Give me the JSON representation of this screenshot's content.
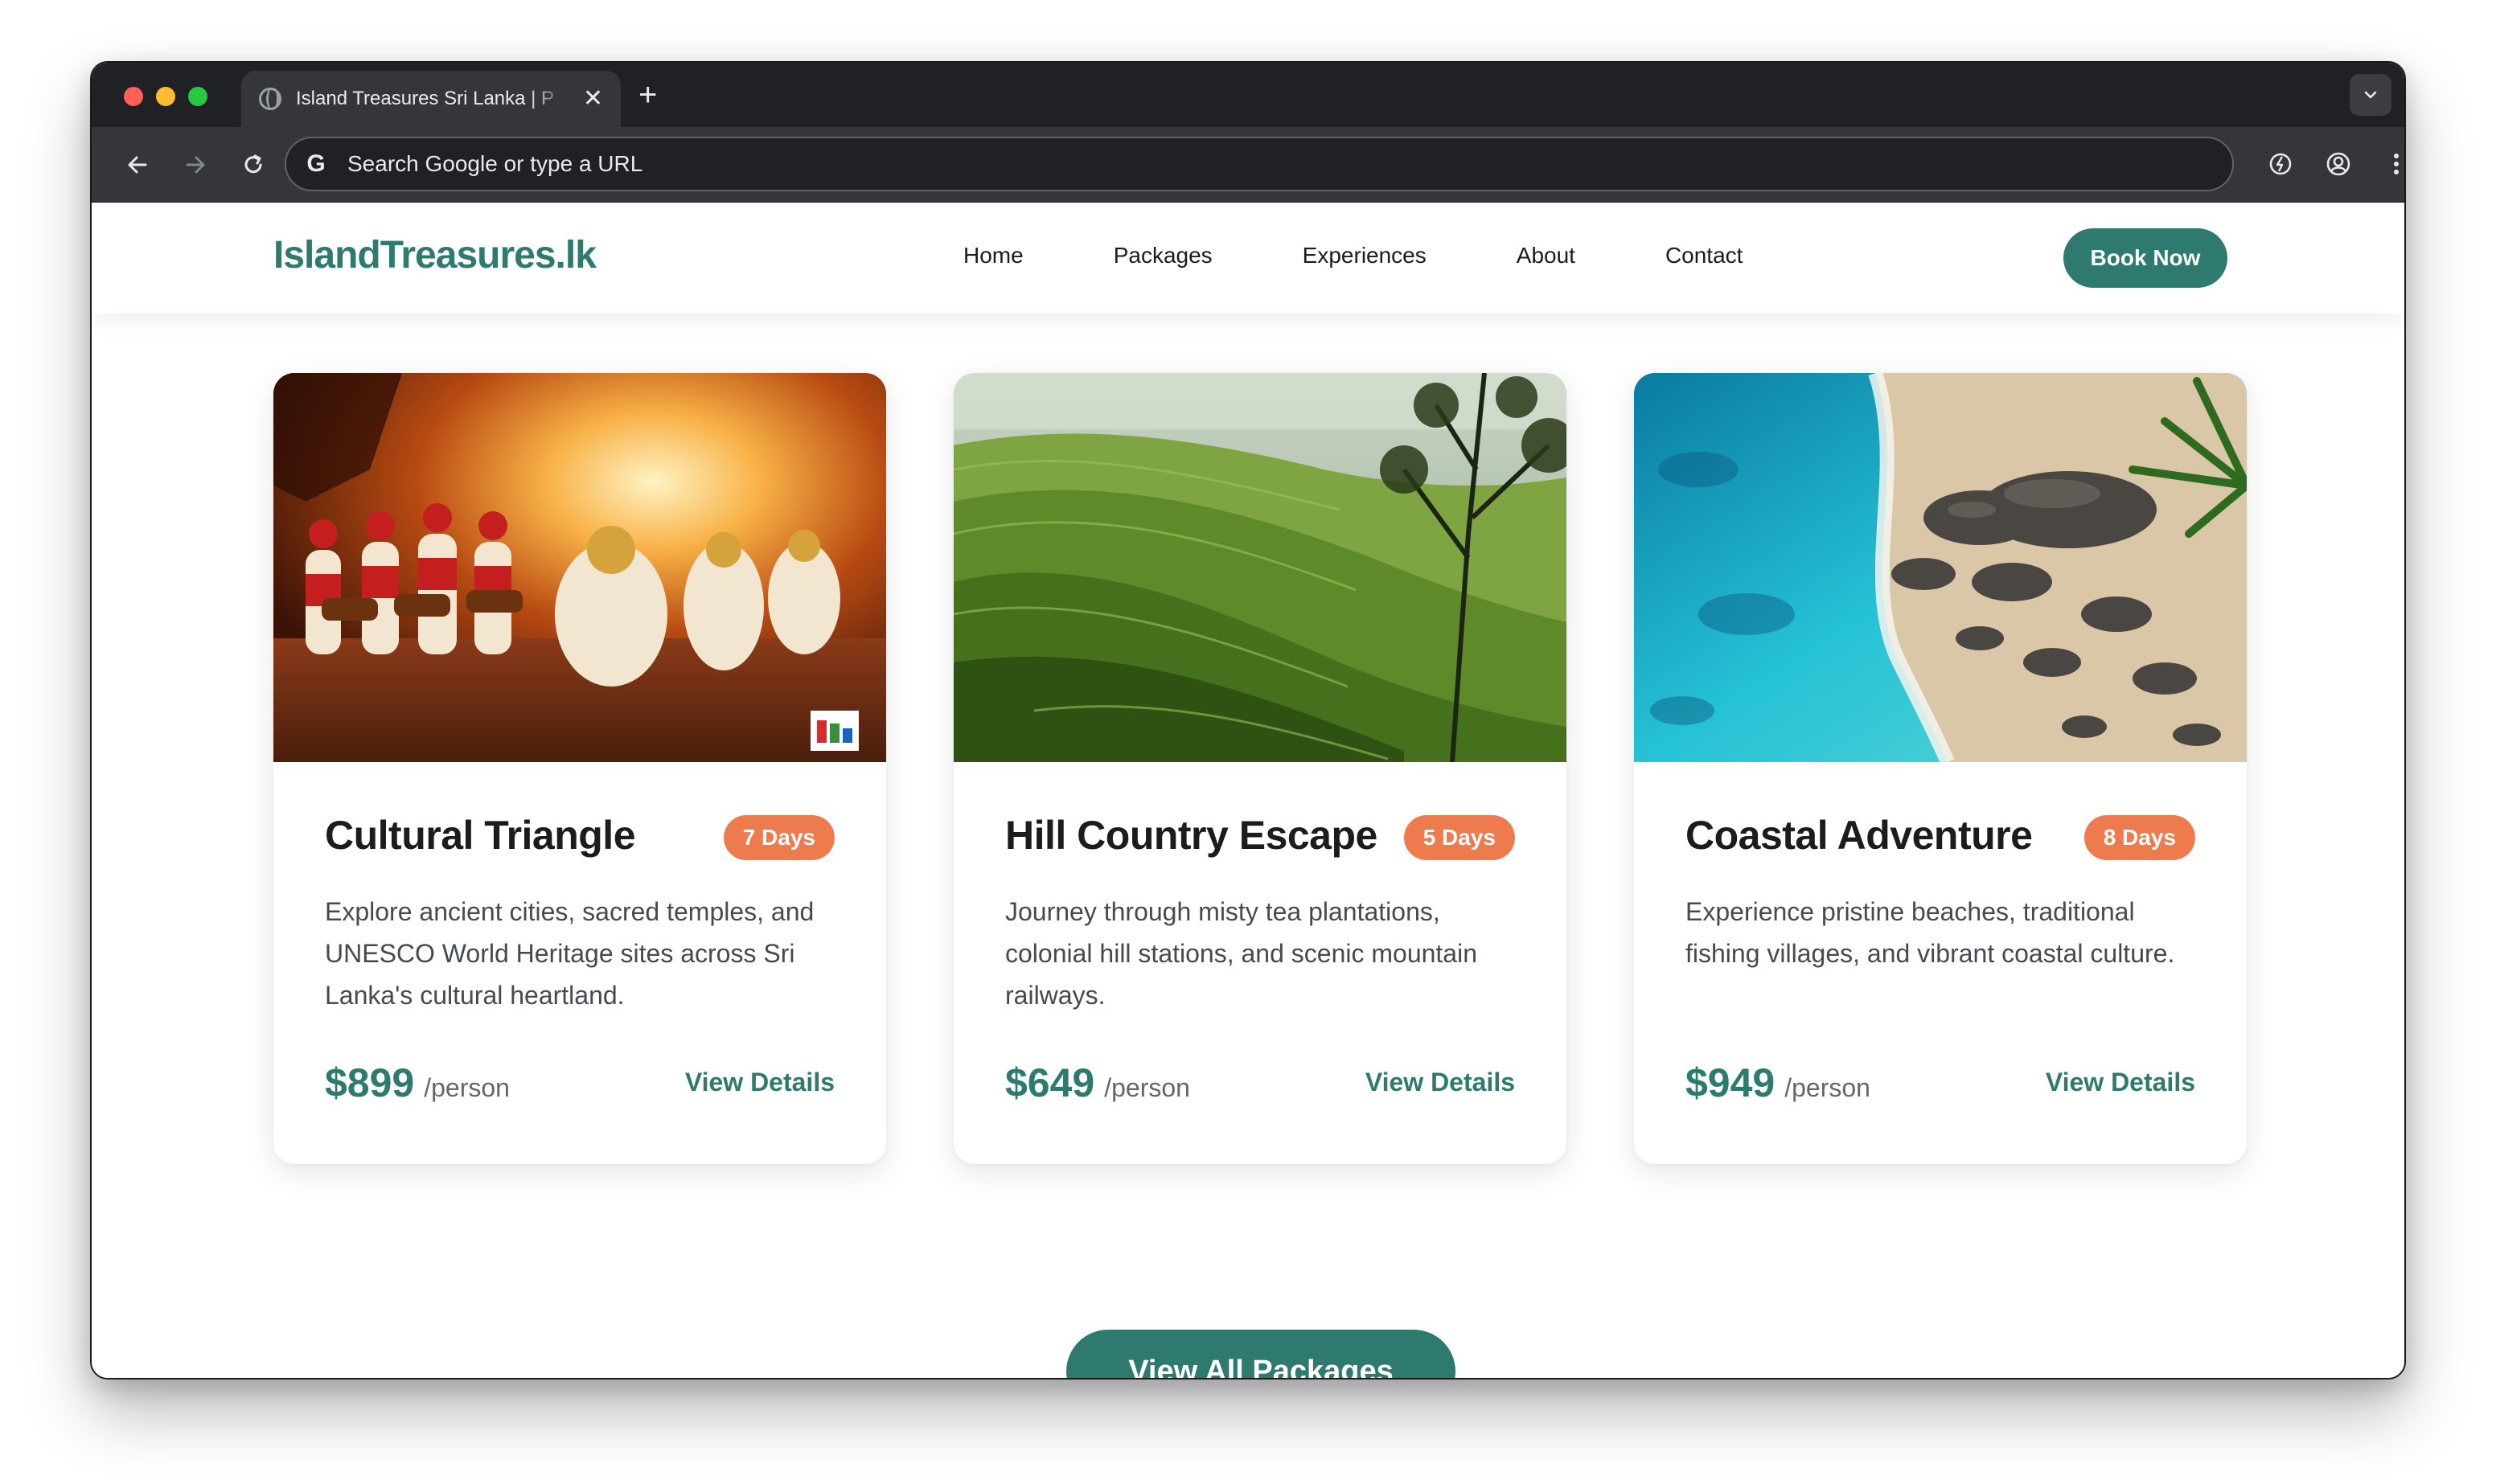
{
  "browser": {
    "tab_title": "Island Treasures Sri Lanka | P",
    "tab_close": "✕",
    "new_tab": "+",
    "address_placeholder": "Search Google or type a URL",
    "google_glyph": "G"
  },
  "site": {
    "brand": "IslandTreasures.lk",
    "nav": [
      "Home",
      "Packages",
      "Experiences",
      "About",
      "Contact"
    ],
    "book_now": "Book Now",
    "accent_color": "#2e7a6f",
    "badge_color": "#ee7b4d"
  },
  "packages": [
    {
      "title": "Cultural Triangle",
      "days": "7 Days",
      "description": "Explore ancient cities, sacred temples, and UNESCO World Heritage sites across Sri Lanka's cultural heartland.",
      "price": "$899",
      "per": "/person",
      "link": "View Details",
      "image": "kandy-perahera-dancers-photo"
    },
    {
      "title": "Hill Country Escape",
      "days": "5 Days",
      "description": "Journey through misty tea plantations, colonial hill stations, and scenic mountain railways.",
      "price": "$649",
      "per": "/person",
      "link": "View Details",
      "image": "tea-plantation-hills-photo"
    },
    {
      "title": "Coastal Adventure",
      "days": "8 Days",
      "description": "Experience pristine beaches, traditional fishing villages, and vibrant coastal culture.",
      "price": "$949",
      "per": "/person",
      "link": "View Details",
      "image": "aerial-beach-rocks-photo"
    }
  ],
  "view_all": "View All Packages"
}
